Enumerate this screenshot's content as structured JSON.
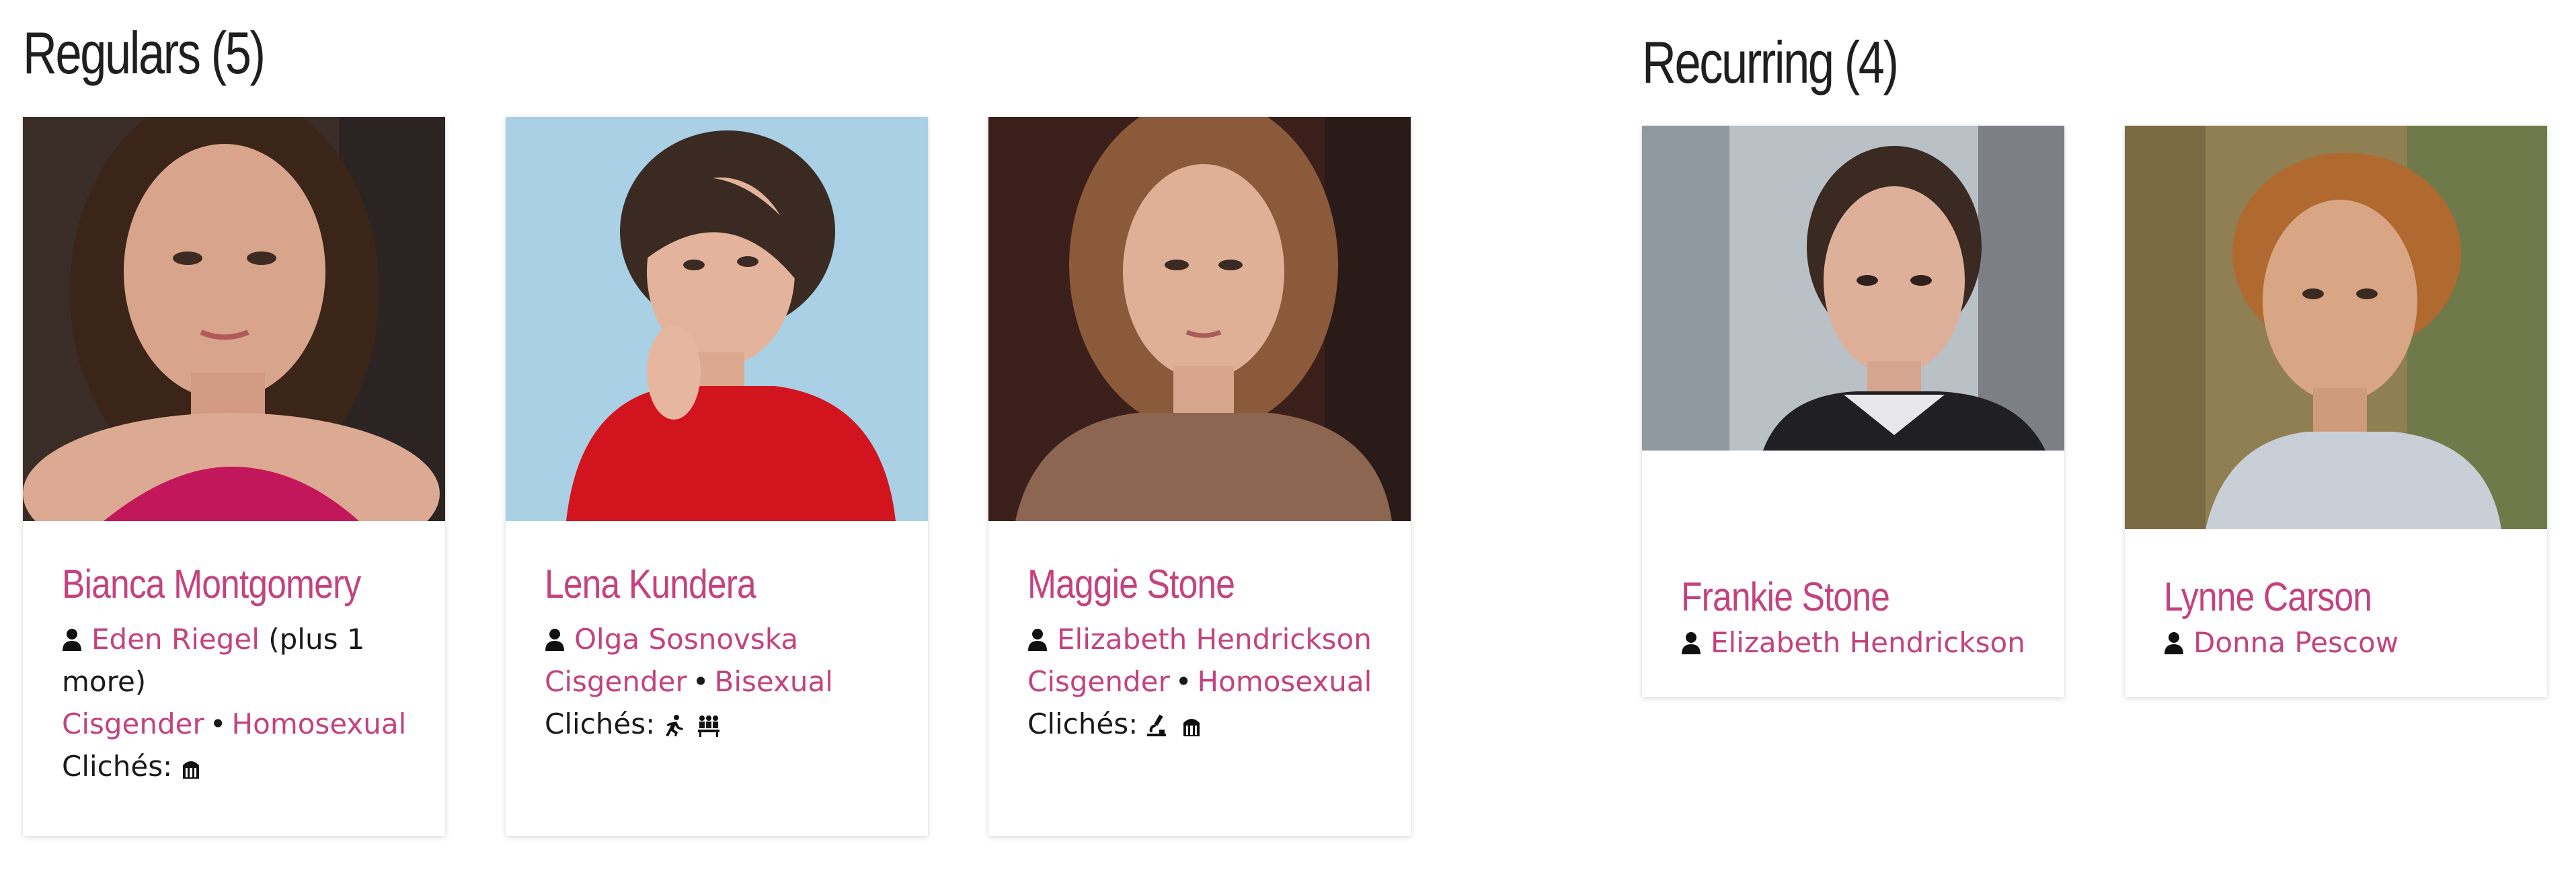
{
  "sections": {
    "regulars": {
      "title": "Regulars (5)",
      "cards": [
        {
          "name": "Bianca Montgomery",
          "actor": "Eden Riegel",
          "actor_extra_1": "(plus 1",
          "actor_extra_2": "more)",
          "gender": "Cisgender",
          "sexuality": "Homosexual",
          "cliches_label": "Clichés:",
          "cliche_icons": [
            "jail-icon"
          ]
        },
        {
          "name": "Lena Kundera",
          "actor": "Olga Sosnovska",
          "gender": "Cisgender",
          "sexuality": "Bisexual",
          "cliches_label": "Clichés:",
          "cliche_icons": [
            "running-person-icon",
            "group-icon"
          ]
        },
        {
          "name": "Maggie Stone",
          "actor": "Elizabeth Hendrickson",
          "gender": "Cisgender",
          "sexuality": "Homosexual",
          "cliches_label": "Clichés:",
          "cliche_icons": [
            "microscope-icon",
            "jail-icon"
          ]
        }
      ]
    },
    "recurring": {
      "title": "Recurring (4)",
      "cards": [
        {
          "name": "Frankie Stone",
          "actor": "Elizabeth Hendrickson"
        },
        {
          "name": "Lynne Carson",
          "actor": "Donna Pescow"
        }
      ]
    }
  },
  "colors": {
    "accent": "#c4427f",
    "text": "#1a1a1a"
  }
}
